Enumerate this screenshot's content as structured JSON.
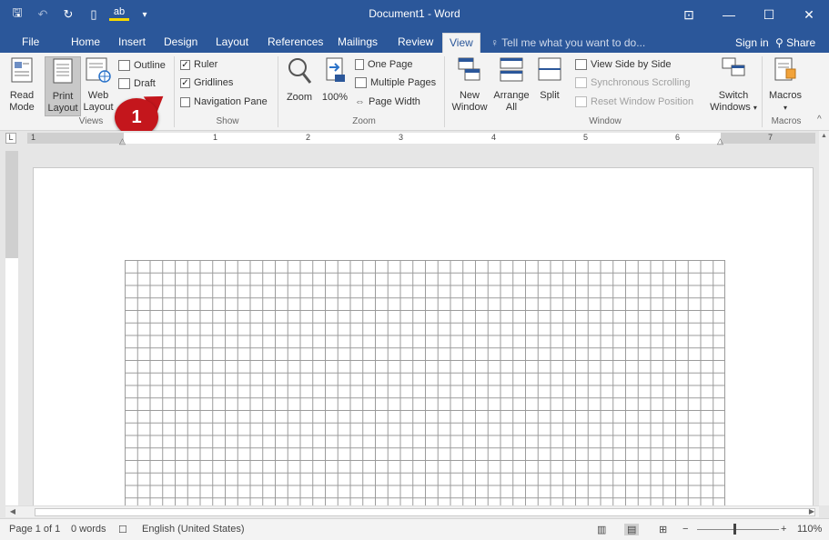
{
  "titlebar": {
    "title": "Document1 - Word",
    "qat": [
      {
        "icon": "save-icon",
        "glyph": "🖫"
      },
      {
        "icon": "undo-icon",
        "glyph": "↶"
      },
      {
        "icon": "redo-icon",
        "glyph": "↻"
      },
      {
        "icon": "new-document-icon",
        "glyph": "▯"
      },
      {
        "icon": "spelling-icon",
        "glyph": "ab"
      },
      {
        "icon": "customize-qat-icon",
        "glyph": "▾"
      }
    ],
    "window_controls": [
      {
        "icon": "ribbon-display-options-icon",
        "glyph": "⊡"
      },
      {
        "icon": "minimize-icon",
        "glyph": "—"
      },
      {
        "icon": "maximize-icon",
        "glyph": "☐"
      },
      {
        "icon": "close-icon",
        "glyph": "✕"
      }
    ]
  },
  "tabs": {
    "file": "File",
    "home": "Home",
    "insert": "Insert",
    "design": "Design",
    "layout": "Layout",
    "references": "References",
    "mailings": "Mailings",
    "review": "Review",
    "view": "View",
    "tell_me": "Tell me what you want to do...",
    "sign_in": "Sign in",
    "share": "Share"
  },
  "ribbon": {
    "views": {
      "label": "Views",
      "read_mode": [
        "Read",
        "Mode"
      ],
      "print_layout": [
        "Print",
        "Layout"
      ],
      "web_layout": [
        "Web",
        "Layout"
      ],
      "outline": "Outline",
      "draft": "Draft"
    },
    "show": {
      "label": "Show",
      "ruler": "Ruler",
      "ruler_checked": true,
      "gridlines": "Gridlines",
      "gridlines_checked": true,
      "navigation_pane": "Navigation Pane",
      "navigation_pane_checked": false
    },
    "zoom": {
      "label": "Zoom",
      "zoom": "Zoom",
      "hundred": "100%",
      "one_page": "One Page",
      "multiple_pages": "Multiple Pages",
      "page_width": "Page Width"
    },
    "window": {
      "label": "Window",
      "new_window": [
        "New",
        "Window"
      ],
      "arrange_all": [
        "Arrange",
        "All"
      ],
      "split": "Split",
      "view_side_by_side": "View Side by Side",
      "synchronous_scrolling": "Synchronous Scrolling",
      "reset_window_position": "Reset Window Position",
      "switch_windows": [
        "Switch",
        "Windows"
      ]
    },
    "macros": {
      "label": "Macros",
      "macros": "Macros"
    }
  },
  "callout": "1",
  "ruler_numbers": [
    "1",
    "1",
    "2",
    "3",
    "4",
    "5",
    "6",
    "7"
  ],
  "status": {
    "page": "Page 1 of 1",
    "words": "0 words",
    "language": "English (United States)",
    "zoom_level": "110%"
  },
  "colors": {
    "accent": "#2b579a",
    "callout": "#c4161c",
    "ribbon_bg": "#f3f3f3"
  }
}
